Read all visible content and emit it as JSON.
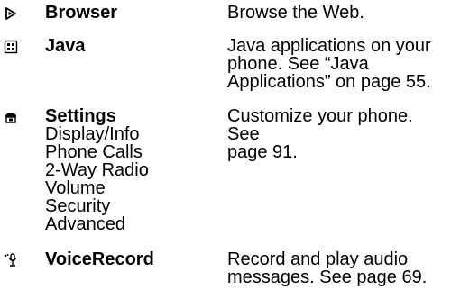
{
  "entries": [
    {
      "icon": "browser-icon",
      "title": "Browser",
      "subitems": [],
      "description": [
        "Browse the Web."
      ]
    },
    {
      "icon": "java-icon",
      "title": "Java",
      "subitems": [],
      "description": [
        "Java applications on your",
        "phone. See “Java",
        "Applications” on page 55."
      ]
    },
    {
      "icon": "settings-icon",
      "title": "Settings",
      "subitems": [
        "Display/Info",
        "Phone Calls",
        "2-Way Radio",
        "Volume",
        "Security",
        "Advanced"
      ],
      "description": [
        "Customize your phone. See",
        "page 91."
      ]
    },
    {
      "icon": "voice-record-icon",
      "title": "VoiceRecord",
      "subitems": [],
      "description": [
        "Record and play audio",
        "messages. See page 69."
      ]
    }
  ]
}
